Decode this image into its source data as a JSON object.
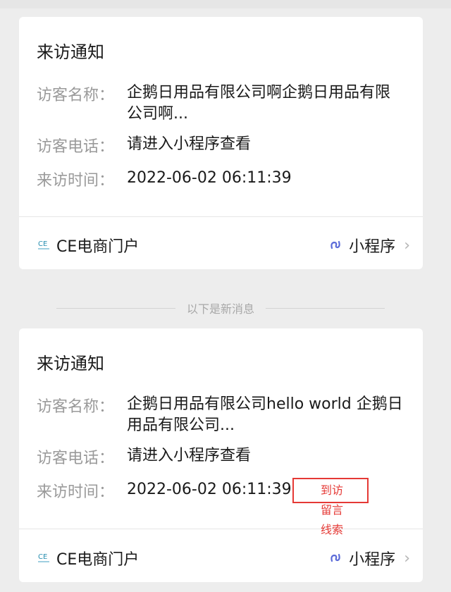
{
  "cards": [
    {
      "title": "来访通知",
      "fields": [
        {
          "label": "访客名称：",
          "value": "企鹅日用品有限公司啊企鹅日用品有限公司啊..."
        },
        {
          "label": "访客电话：",
          "value": "请进入小程序查看"
        },
        {
          "label": "来访时间：",
          "value": "2022-06-02 06:11:39"
        }
      ],
      "footer": {
        "brand": "CE电商门户",
        "mini": "小程序",
        "chevron": "›"
      }
    },
    {
      "title": "来访通知",
      "fields": [
        {
          "label": "访客名称：",
          "value": "企鹅日用品有限公司hello world 企鹅日用品有限公司..."
        },
        {
          "label": "访客电话：",
          "value": "请进入小程序查看"
        },
        {
          "label": "来访时间：",
          "value": "2022-06-02 06:11:39"
        }
      ],
      "footer": {
        "brand": "CE电商门户",
        "mini": "小程序",
        "chevron": "›"
      }
    }
  ],
  "separator": "以下是新消息",
  "annotation": "到访留言线索",
  "colors": {
    "annotation": "#e53935",
    "mini_icon": "#5b6bd8",
    "logo": "#2a8fb0"
  },
  "icons": {
    "logo": "ce-logo-icon",
    "mini": "mini-program-icon",
    "chevron": "chevron-right-icon"
  }
}
